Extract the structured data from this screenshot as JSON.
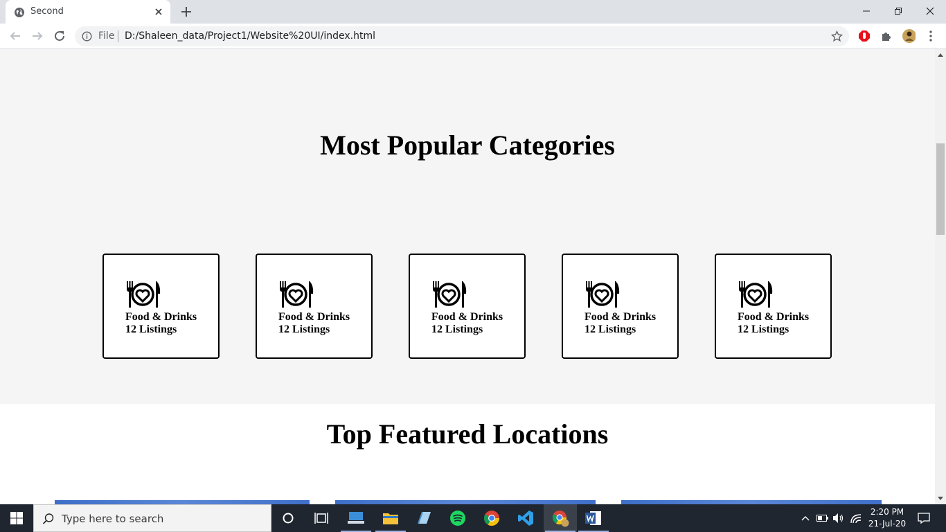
{
  "browser": {
    "tab_title": "Second",
    "address": {
      "scheme_label": "File",
      "url": "D:/Shaleen_data/Project1/Website%20UI/index.html"
    }
  },
  "page": {
    "categories_heading": "Most Popular Categories",
    "categories": [
      {
        "title": "Food & Drinks",
        "count": "12 Listings",
        "icon": "restaurant-icon"
      },
      {
        "title": "Food & Drinks",
        "count": "12 Listings",
        "icon": "restaurant-icon"
      },
      {
        "title": "Food & Drinks",
        "count": "12 Listings",
        "icon": "restaurant-icon"
      },
      {
        "title": "Food & Drinks",
        "count": "12 Listings",
        "icon": "restaurant-icon"
      },
      {
        "title": "Food & Drinks",
        "count": "12 Listings",
        "icon": "restaurant-icon"
      }
    ],
    "locations_heading": "Top Featured Locations"
  },
  "taskbar": {
    "search_placeholder": "Type here to search",
    "time": "2:20 PM",
    "date": "21-Jul-20"
  },
  "colors": {
    "section_background": "#f5f5f5",
    "taskbar": "#1f2630",
    "tab_strip": "#dee1e6"
  }
}
